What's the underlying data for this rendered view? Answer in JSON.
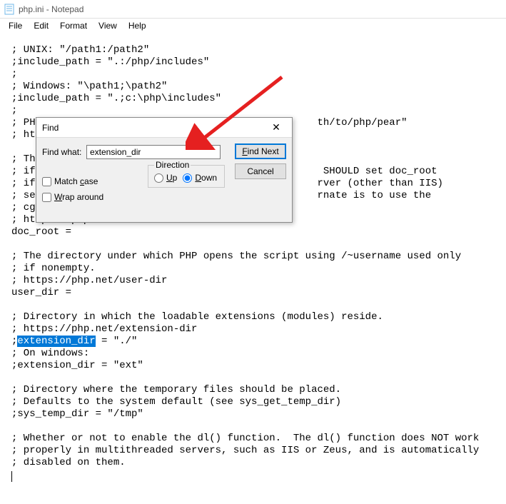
{
  "window": {
    "title": "php.ini - Notepad"
  },
  "menu": {
    "file": "File",
    "edit": "Edit",
    "format": "Format",
    "view": "View",
    "help": "Help"
  },
  "editor": {
    "line01": "; UNIX: \"/path1:/path2\"",
    "line02": ";include_path = \".:/php/includes\"",
    "line03": ";",
    "line04": "; Windows: \"\\path1;\\path2\"",
    "line05": ";include_path = \".;c:\\php\\includes\"",
    "line06": ";",
    "line07a": "; PHP'",
    "line07b": "th/to/php/pear\"",
    "line08": "; http",
    "line09": "",
    "line10": "; The ",
    "line11a": "; if P",
    "line11b": " SHOULD set doc_root",
    "line12a": "; if y",
    "line12b": "rver (other than IIS)",
    "line13a": "; see ",
    "line13b": "rnate is to use the",
    "line14": "; cgi.",
    "line15": "; https://php.net/doc-root",
    "line16": "doc_root =",
    "line17": "",
    "line18": "; The directory under which PHP opens the script using /~username used only",
    "line19": "; if nonempty.",
    "line20": "; https://php.net/user-dir",
    "line21": "user_dir =",
    "line22": "",
    "line23": "; Directory in which the loadable extensions (modules) reside.",
    "line24": "; https://php.net/extension-dir",
    "line25a": ";",
    "line25hl": "extension_dir",
    "line25b": " = \"./\"",
    "line26": "; On windows:",
    "line27": ";extension_dir = \"ext\"",
    "line28": "",
    "line29": "; Directory where the temporary files should be placed.",
    "line30": "; Defaults to the system default (see sys_get_temp_dir)",
    "line31": ";sys_temp_dir = \"/tmp\"",
    "line32": "",
    "line33": "; Whether or not to enable the dl() function.  The dl() function does NOT work",
    "line34": "; properly in multithreaded servers, such as IIS or Zeus, and is automatically",
    "line35": "; disabled on them."
  },
  "dialog": {
    "title": "Find",
    "find_what_label": "Find what:",
    "find_what_value": "extension_dir",
    "find_next": "Find Next",
    "cancel": "Cancel",
    "match_case": "Match case",
    "wrap_around": "Wrap around",
    "direction": "Direction",
    "up": "Up",
    "down": "Down"
  }
}
